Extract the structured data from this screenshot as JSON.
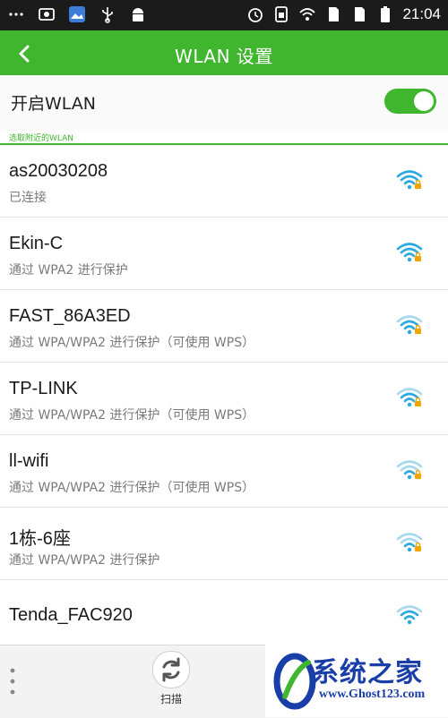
{
  "status_bar": {
    "time": "21:04",
    "left_icons": [
      "more-icon",
      "screenshot-icon",
      "gallery-icon",
      "usb-icon",
      "android-icon"
    ],
    "right_icons": [
      "alarm-icon",
      "phone-icon",
      "wifi-signal-icon",
      "sim-icon",
      "sim-icon",
      "battery-icon"
    ]
  },
  "header": {
    "title": "WLAN 设置",
    "back_icon": "chevron-left-icon"
  },
  "wlan_toggle": {
    "label": "开启WLAN",
    "on": true,
    "section_label": "选取附近的WLAN"
  },
  "networks": [
    {
      "name": "as20030208",
      "status": "已连接",
      "signal_color": "#2aa9e0",
      "locked": true
    },
    {
      "name": "Ekin-C",
      "status": "通过 WPA2 进行保护",
      "signal_color": "#2aa9e0",
      "locked": true
    },
    {
      "name": "FAST_86A3ED",
      "status": "通过 WPA/WPA2 进行保护（可使用 WPS）",
      "signal_color": "#2aa9e0",
      "locked": true
    },
    {
      "name": "TP-LINK",
      "status": "通过 WPA/WPA2 进行保护（可使用 WPS）",
      "signal_color": "#2aa9e0",
      "locked": true
    },
    {
      "name": "ll-wifi",
      "status": "通过 WPA/WPA2 进行保护（可使用 WPS）",
      "signal_color": "#2aa9e0",
      "locked": true
    },
    {
      "name": "1栋-6座",
      "status": "通过 WPA/WPA2 进行保护",
      "signal_color": "#2aa9e0",
      "locked": true
    },
    {
      "name": "Tenda_FAC920",
      "status": "",
      "signal_color": "#2aa9e0",
      "locked": false
    }
  ],
  "bottom_bar": {
    "scan_label": "扫描",
    "scan_icon": "refresh-icon",
    "menu_icon": "more-vertical-icon"
  },
  "watermark": {
    "text": "系统之家",
    "url": "www.Ghost123.com"
  },
  "colors": {
    "accent": "#3fb62e",
    "wifi": "#2aa9e0",
    "lock": "#f0a500"
  }
}
